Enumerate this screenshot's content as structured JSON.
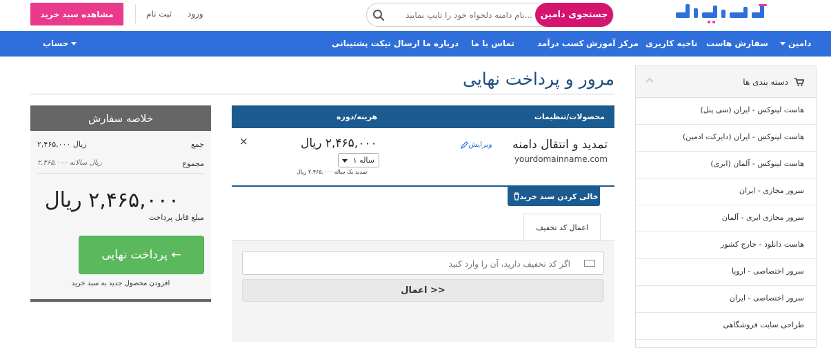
{
  "header": {
    "search_button": "جستجوی دامین",
    "search_placeholder": "...نام دامنه دلخواه خود را تایپ نمایید",
    "login": "ورود",
    "register": "ثبت نام",
    "view_cart": "مشاهده سبد خرید",
    "brand_color": "#2f6fdc"
  },
  "nav": {
    "items": [
      "دامین",
      "سفارش هاست",
      "ناحیه کاربری",
      "مرکز آموزش",
      "کسب درآمد",
      "تماس با ما",
      "درباره ما",
      "ارسال تیکت پشتیبانی"
    ],
    "account": "حساب"
  },
  "page": {
    "title": "مرور و پرداخت نهایی"
  },
  "sidebar": {
    "heading": "دسته بندی ها",
    "items": [
      "هاست لینوکس - ایران (سی پنل)",
      "هاست لینوکس - ایران (دایرکت ادمین)",
      "هاست لینوکس - آلمان (ابری)",
      "سرور مجازی - ایران",
      "سرور مجازی ابری - آلمان",
      "هاست دانلود - خارج کشور",
      "سرور اختصاصی - اروپا",
      "سرور اختصاصی - ایران",
      "طراحی سایت فروشگاهی"
    ]
  },
  "cart": {
    "col_products": "محصولات/تنظیمات",
    "col_price": "هزینه/دوره",
    "item_title": "تمدید و انتقال دامنه",
    "item_domain": "yourdomainname.com",
    "edit": "ویرایش",
    "price": "۲,۴۶۵,۰۰۰ ریال",
    "period": "۱ ساله",
    "renew_note": "تمدید یک ساله ۲,۴۶۵,۰۰۰ ریال",
    "remove": "×",
    "empty_cart": "خالی کردن سبد خرید"
  },
  "promo": {
    "tab": "اعمال کد تخفیف",
    "placeholder": "اگر کد تخفیف دارید، آن را وارد کنید",
    "apply": "اعمال >>"
  },
  "summary": {
    "heading": "خلاصه سفارش",
    "subtotal_label": "جمع",
    "subtotal_value": "۲,۴۶۵,۰۰۰ ریال",
    "recurring_label": "مجموع",
    "recurring_value": "۲,۴۶۵,۰۰۰ ریال سالانه",
    "total": "۲,۴۶۵,۰۰۰ ریال",
    "total_label": "مبلغ قابل پرداخت",
    "checkout": "پرداخت نهایی ←",
    "continue": "افزودن محصول جدید به سبد خرید"
  }
}
